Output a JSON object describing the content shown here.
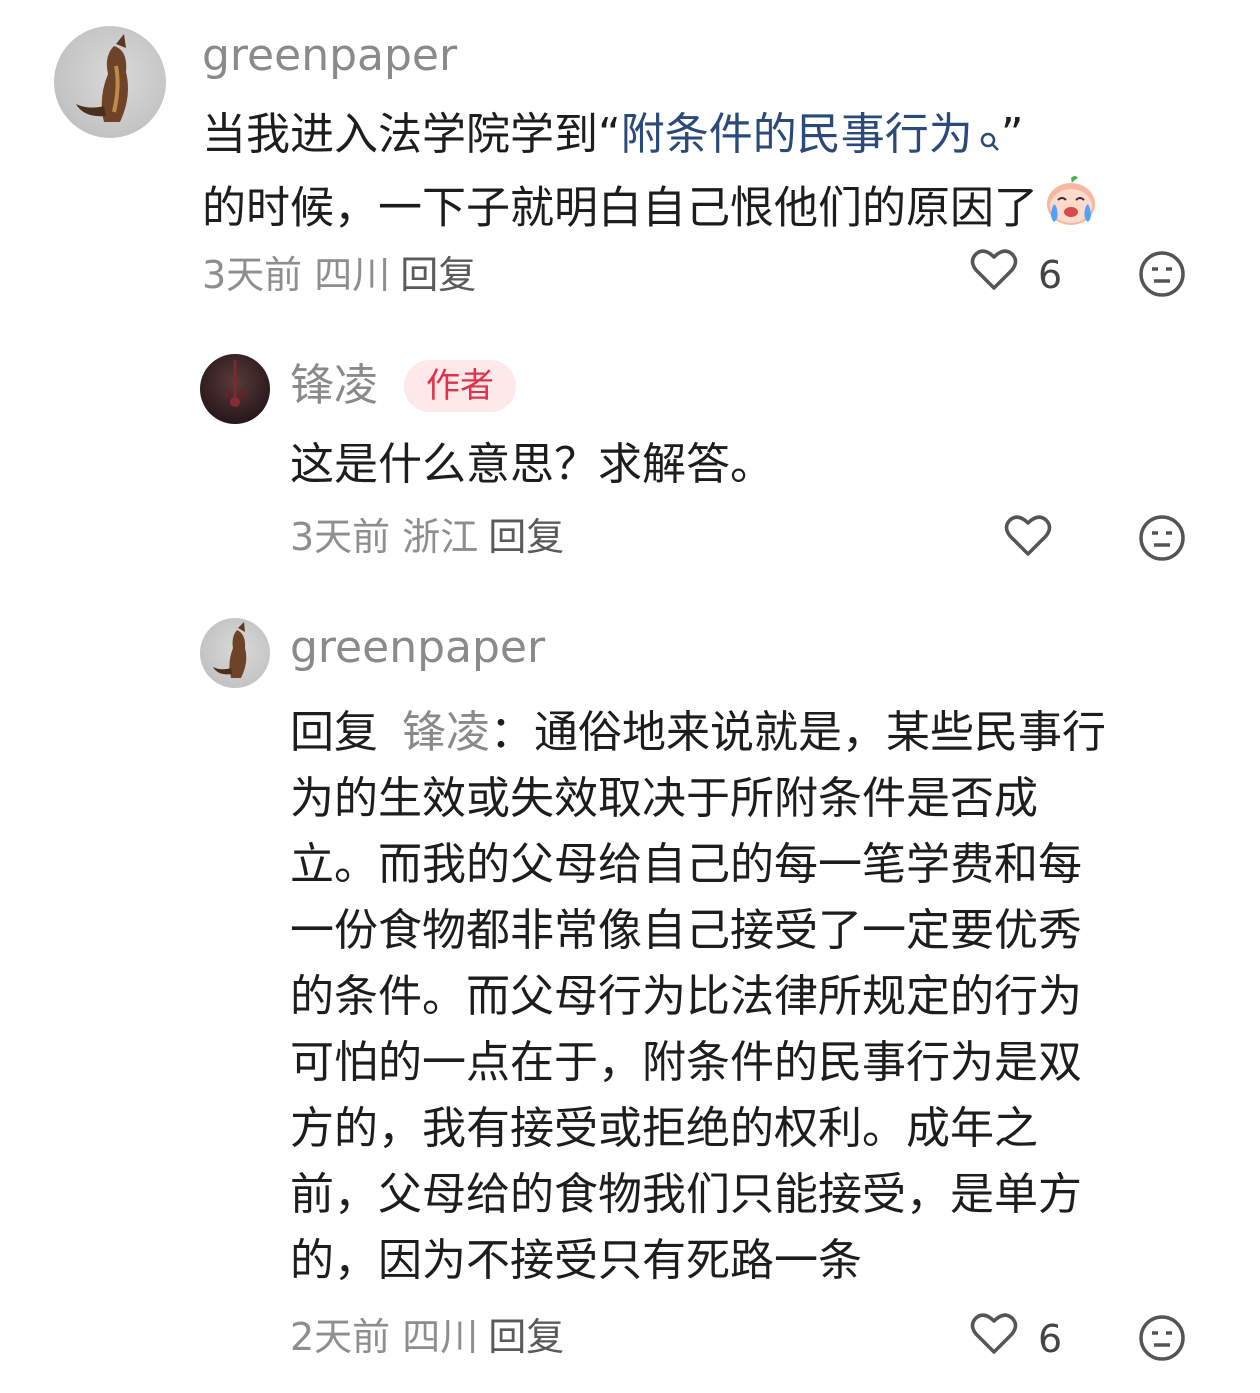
{
  "comments": [
    {
      "username": "greenpaper",
      "text_prefix": "当我进入法学院学到“",
      "keyword": "附条件的民事行为",
      "text_suffix_line1": "”",
      "text_line2": "的时候，一下子就明白自己恨他们的原因了",
      "emoji": "crying-peach-emoji",
      "time": "3天前",
      "location": "四川",
      "reply_label": "回复",
      "likes": "6"
    }
  ],
  "replies": [
    {
      "username": "锋凌",
      "badge": "作者",
      "text": "这是什么意思？求解答。",
      "time": "3天前",
      "location": "浙江",
      "reply_label": "回复",
      "likes": ""
    },
    {
      "username": "greenpaper",
      "reply_prefix": "回复",
      "reply_to": "锋凌",
      "colon": "：",
      "lines": [
        "通俗地来说就是，某些民事行",
        "为的生效或失效取决于所附条件是否成",
        "立。而我的父母给自己的每一笔学费和每",
        "一份食物都非常像自己接受了一定要优秀",
        "的条件。而父母行为比法律所规定的行为",
        "可怕的一点在于，附条件的民事行为是双",
        "方的，我有接受或拒绝的权利。成年之",
        "前，父母给的食物我们只能接受，是单方",
        "的，因为不接受只有死路一条"
      ],
      "time": "2天前",
      "location": "四川",
      "reply_label": "回复",
      "likes": "6"
    }
  ],
  "icons": {
    "like": "heart-outline-icon",
    "dislike": "neutral-face-icon",
    "keyword_search": "search-icon"
  },
  "colors": {
    "meta": "#8e8e8e",
    "keyword": "#2a4a7a",
    "badge_bg": "#fde8ea",
    "badge_text": "#e0334b"
  }
}
